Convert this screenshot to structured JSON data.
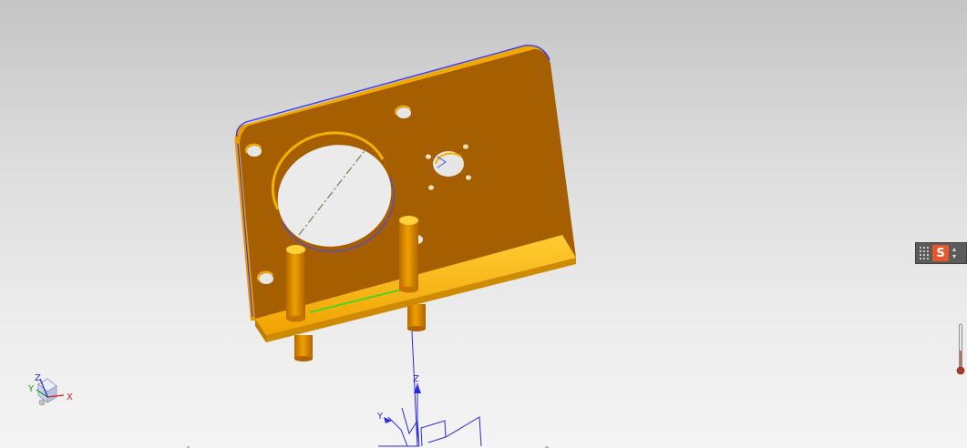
{
  "viewport": {
    "background_top": "#c5c5c5",
    "background_bottom": "#f4f4f4"
  },
  "model": {
    "plate_color": "#a55f00",
    "flange_color": "#f2a500",
    "pin_color": "#e08c00",
    "edge_highlight": "#3a3af0",
    "selected_edge": "#21e021"
  },
  "view_triad": {
    "x_label": "X",
    "y_label": "Y",
    "z_label": "Z",
    "x_color": "#d21a1a",
    "y_color": "#1a9a1a",
    "z_color": "#2a2ad0"
  },
  "datum_csys": {
    "z_label": "Z",
    "y_label": "Y",
    "color": "#2a2ae0"
  },
  "ime_toolbar": {
    "logo_text": "S",
    "menu_up": "▴",
    "menu_down": "▾",
    "icon": "sogou-ime-icon"
  },
  "side_indicator": {
    "icon": "thermometer-icon",
    "color": "#b03a2a"
  }
}
